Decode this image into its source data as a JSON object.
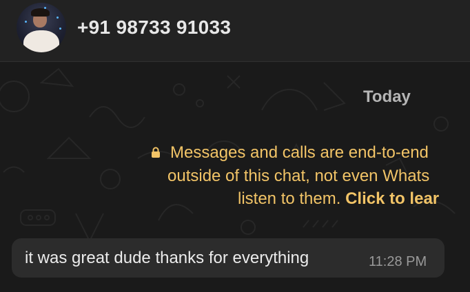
{
  "header": {
    "contact_name": "+91 98733 91033",
    "avatar_icon": "profile-photo"
  },
  "chat": {
    "date_label": "Today",
    "encryption_notice": {
      "icon": "lock-icon",
      "line1": "Messages and calls are end-to-end",
      "line2": "outside of this chat, not even Whats",
      "line3_text": "listen to them.",
      "line3_link": "Click to lear"
    },
    "messages": [
      {
        "text": "it was great dude thanks for everything",
        "time": "11:28 PM"
      }
    ]
  },
  "colors": {
    "header_bg": "#222222",
    "chat_bg": "#1a1a1a",
    "bubble_bg": "#2c2c2c",
    "notice_text": "#f2c467"
  }
}
